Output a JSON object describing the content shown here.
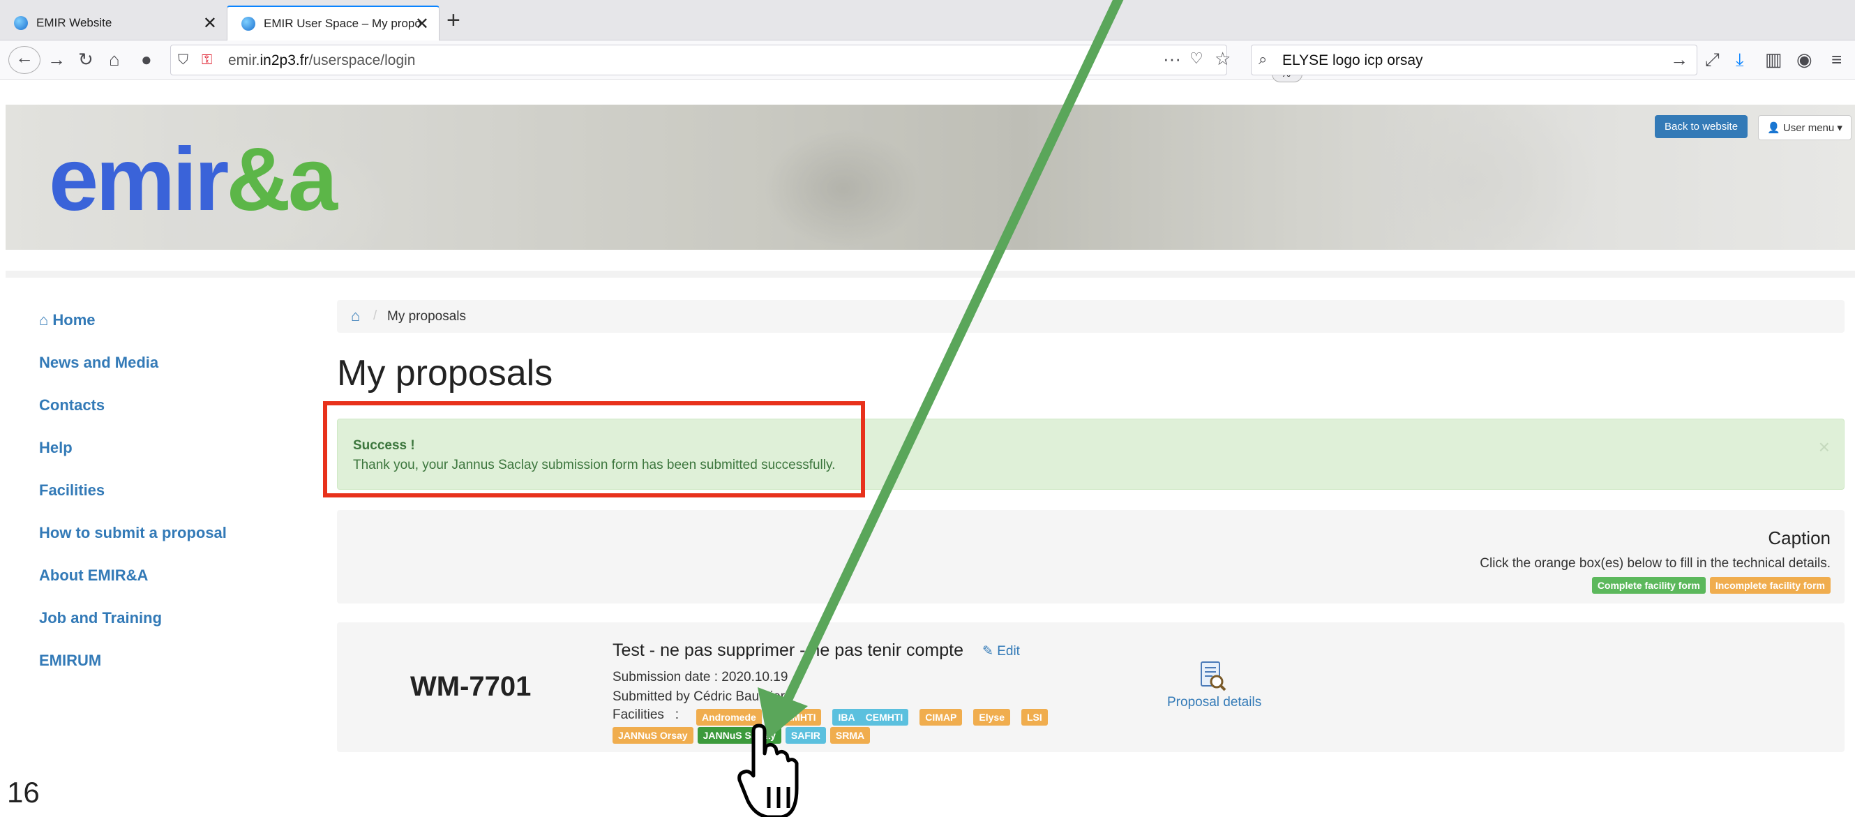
{
  "browser": {
    "tabs": [
      {
        "label": "EMIR Website"
      },
      {
        "label": "EMIR User Space – My proposal"
      }
    ],
    "url_prefix": "emir.",
    "url_domain": "in2p3.fr",
    "url_path": "/userspace/login",
    "zoom": "80 %",
    "search_value": "ELYSE logo icp orsay"
  },
  "header": {
    "logo_part1": "emir",
    "logo_part2": "&a",
    "back_to_website": "Back to website",
    "user_menu": "User menu"
  },
  "sidebar": {
    "items": [
      {
        "label": "Home"
      },
      {
        "label": "News and Media"
      },
      {
        "label": "Contacts"
      },
      {
        "label": "Help"
      },
      {
        "label": "Facilities"
      },
      {
        "label": "How to submit a proposal"
      },
      {
        "label": "About EMIR&A"
      },
      {
        "label": "Job and Training"
      },
      {
        "label": "EMIRUM"
      }
    ]
  },
  "breadcrumb": {
    "current": "My proposals"
  },
  "page_title": "My proposals",
  "alert": {
    "title": "Success !",
    "message": "Thank you, your Jannus Saclay submission form has been submitted successfully."
  },
  "caption": {
    "title": "Caption",
    "text": "Click the orange box(es) below to fill in the technical details.",
    "complete": "Complete facility form",
    "incomplete": "Incomplete facility form"
  },
  "proposal": {
    "id": "WM-7701",
    "title": "Test - ne pas supprimer - ne pas tenir compte",
    "edit": "Edit",
    "date": "Submission date : 2020.10.19",
    "submitted_by": "Submitted by Cédric Baumier",
    "facilities_label": "Facilities   :",
    "details": "Proposal details",
    "facilities_row1": [
      {
        "name": "Andromede",
        "status": "orange"
      },
      {
        "name": "CEMHTI",
        "status": "orange"
      },
      {
        "name": "IBA    CEMHTI",
        "status": "blue"
      },
      {
        "name": "CIMAP",
        "status": "orange"
      },
      {
        "name": "Elyse",
        "status": "orange"
      },
      {
        "name": "LSI",
        "status": "orange"
      }
    ],
    "facilities_row2": [
      {
        "name": "JANNuS Orsay",
        "status": "orange"
      },
      {
        "name": "JANNuS Saclay",
        "status": "green"
      },
      {
        "name": "SAFIR",
        "status": "blue"
      },
      {
        "name": "SRMA",
        "status": "orange"
      }
    ]
  },
  "slide_number": "16",
  "colors": {
    "link": "#337ab7",
    "success_bg": "#dff0d8",
    "highlight": "#e8311b",
    "arrow": "#5aa65a"
  }
}
